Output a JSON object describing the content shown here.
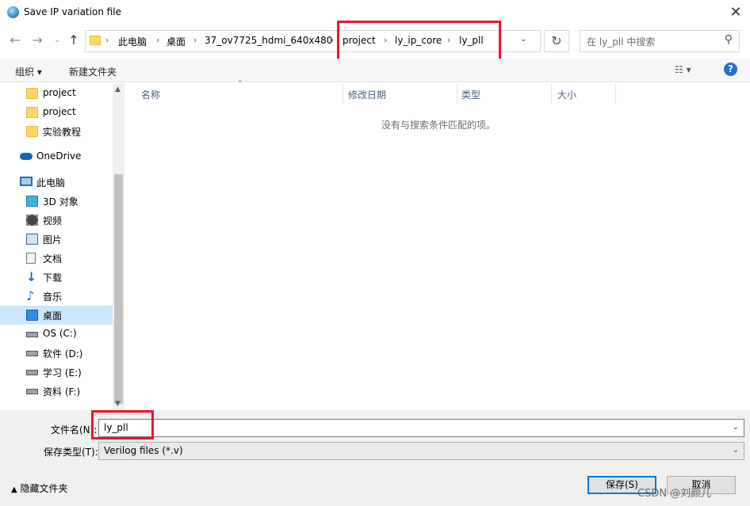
{
  "window": {
    "title": "Save IP variation file",
    "close_symbol": "✕"
  },
  "address": {
    "crumbs": [
      "此电脑",
      "桌面",
      "37_ov7725_hdmi_640x480",
      "project",
      "ly_ip_core",
      "ly_pll"
    ],
    "separator": "›",
    "search_placeholder": "在 ly_pll 中搜索"
  },
  "toolbar": {
    "organize": "组织 ▾",
    "new_folder": "新建文件夹",
    "help": "?"
  },
  "nav": {
    "items": [
      {
        "label": "project",
        "icon": "folder-icon"
      },
      {
        "label": "project",
        "icon": "folder-icon"
      },
      {
        "label": "实验教程",
        "icon": "folder-icon"
      },
      {
        "label": "OneDrive",
        "icon": "cloud-icon"
      },
      {
        "label": "此电脑",
        "icon": "computer-icon"
      },
      {
        "label": "3D 对象",
        "icon": "cube-icon"
      },
      {
        "label": "视频",
        "icon": "video-icon"
      },
      {
        "label": "图片",
        "icon": "picture-icon"
      },
      {
        "label": "文档",
        "icon": "document-icon"
      },
      {
        "label": "下载",
        "icon": "download-icon"
      },
      {
        "label": "音乐",
        "icon": "music-icon"
      },
      {
        "label": "桌面",
        "icon": "desktop-icon",
        "selected": true
      },
      {
        "label": "OS (C:)",
        "icon": "os-drive-icon"
      },
      {
        "label": "软件 (D:)",
        "icon": "drive-icon"
      },
      {
        "label": "学习 (E:)",
        "icon": "drive-icon"
      },
      {
        "label": "资料 (F:)",
        "icon": "drive-icon"
      }
    ]
  },
  "list": {
    "columns": [
      "名称",
      "修改日期",
      "类型",
      "大小"
    ],
    "empty_message": "没有与搜索条件匹配的项。"
  },
  "form": {
    "filename_label": "文件名(N):",
    "filename_value": "ly_pll",
    "filetype_label": "保存类型(T):",
    "filetype_value": "Verilog files (*.v)",
    "hide_folders": "隐藏文件夹",
    "save": "保存(S)",
    "cancel": "取消"
  },
  "watermark": "CSDN @刘颜儿",
  "colors": {
    "highlight_box": "#e8182b",
    "accent": "#0078d7",
    "selected_bg": "#cce8ff"
  }
}
